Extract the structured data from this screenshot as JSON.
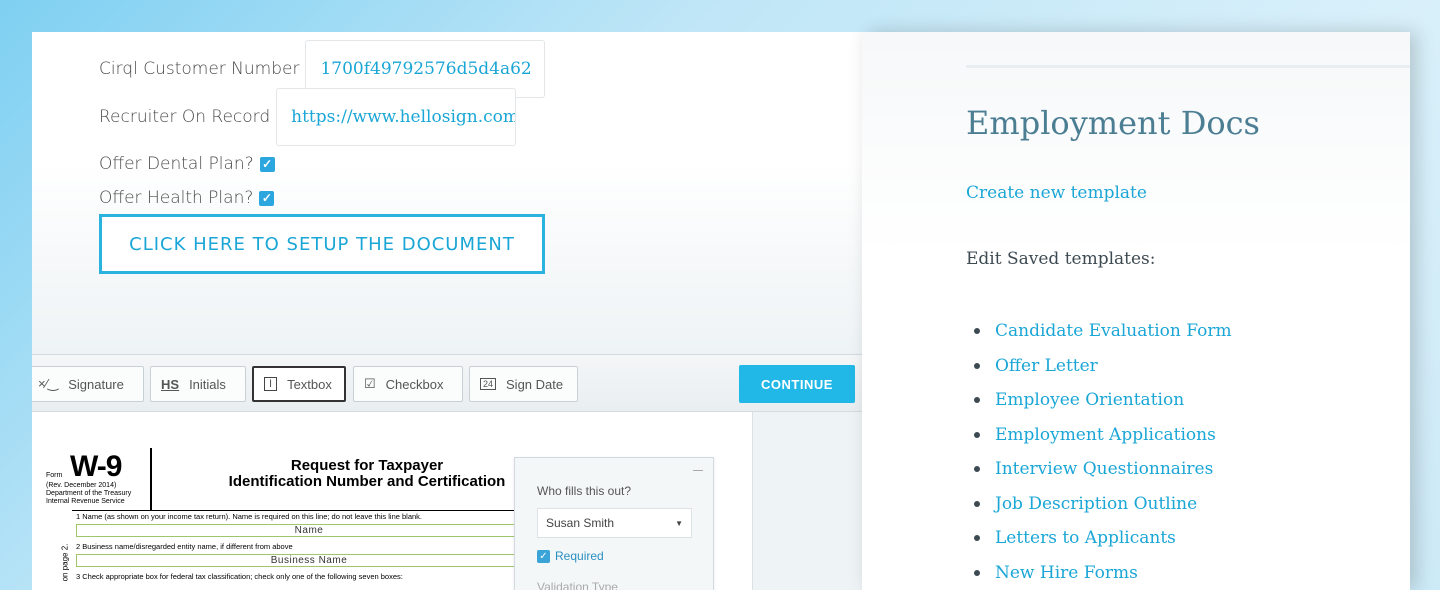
{
  "form": {
    "customer_number_label": "Cirql Customer Number",
    "customer_number_value": "1700f49792576d5d4a62",
    "recruiter_label": "Recruiter On Record",
    "recruiter_value": "https://www.hellosign.com",
    "dental_label": "Offer Dental Plan?",
    "dental_checked": true,
    "health_label": "Offer Health Plan?",
    "health_checked": true,
    "setup_button": "CLICK HERE TO SETUP THE DOCUMENT"
  },
  "toolbar": {
    "signature": "Signature",
    "initials_icon": "HS",
    "initials": "Initials",
    "textbox": "Textbox",
    "checkbox": "Checkbox",
    "signdate_icon": "24",
    "signdate": "Sign Date",
    "continue": "CONTINUE"
  },
  "document": {
    "form_word": "Form",
    "form_number": "W-9",
    "rev": "(Rev. December 2014)",
    "dept": "Department of the Treasury",
    "irs": "Internal Revenue Service",
    "title_line1": "Request for Taxpayer",
    "title_line2": "Identification Number and Certification",
    "line1": "1 Name (as shown on your income tax return). Name is required on this line; do not leave this line blank.",
    "field1": "Name",
    "line2": "2 Business name/disregarded entity name, if different from above",
    "field2": "Business Name",
    "line3": "3 Check appropriate box for federal tax classification; check only one of the following seven boxes:",
    "side_text": "on page 2."
  },
  "popover": {
    "question": "Who fills this out?",
    "signer": "Susan Smith",
    "required_label": "Required",
    "more": "Validation Type"
  },
  "sidebar": {
    "title": "Employment Docs",
    "create_link": "Create new template",
    "edit_label": "Edit Saved templates:",
    "templates": [
      "Candidate Evaluation Form",
      "Offer Letter",
      "Employee Orientation",
      "Employment Applications",
      "Interview Questionnaires",
      "Job Description Outline",
      "Letters to Applicants",
      "New Hire Forms"
    ]
  }
}
